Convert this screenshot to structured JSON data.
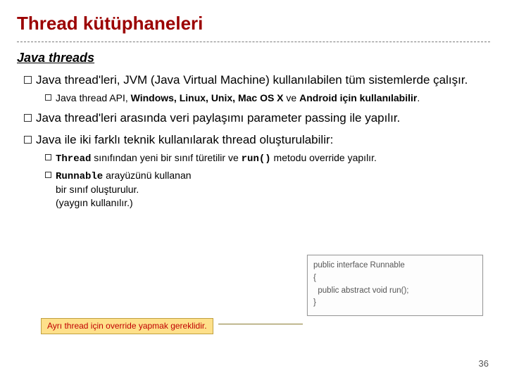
{
  "title": "Thread kütüphaneleri",
  "section_heading": "Java threads",
  "b1": {
    "pre": "Java thread'leri, JVM (Java Virtual Machine) kullanılabilen tüm sistemlerde çalışır.",
    "sub_pre": "Java thread API, ",
    "sub_bold": "Windows, Linux, Unix, Mac OS X",
    "sub_mid": " ve ",
    "sub_bold2": "Android için kullanılabilir",
    "sub_post": "."
  },
  "b2": "Java thread'leri arasında veri paylaşımı parameter passing ile yapılır.",
  "b3": "Java ile iki farklı teknik kullanılarak thread oluşturulabilir:",
  "b3a": {
    "code1": "Thread",
    "mid1": " sınıfından yeni bir sınıf türetilir ve ",
    "code2": "run()",
    "mid2": " metodu override yapılır."
  },
  "b3b": {
    "code1": "Runnable",
    "mid1": " arayüzünü kullanan",
    "line2": "bir sınıf oluşturulur.",
    "line3": "(yaygın kullanılır.)"
  },
  "code_snippet": {
    "l1": "public interface Runnable",
    "l2": "{",
    "l3": "  public abstract void run();",
    "l4": "}"
  },
  "callout": "Ayrı thread için override yapmak gereklidir.",
  "page_num": "36"
}
